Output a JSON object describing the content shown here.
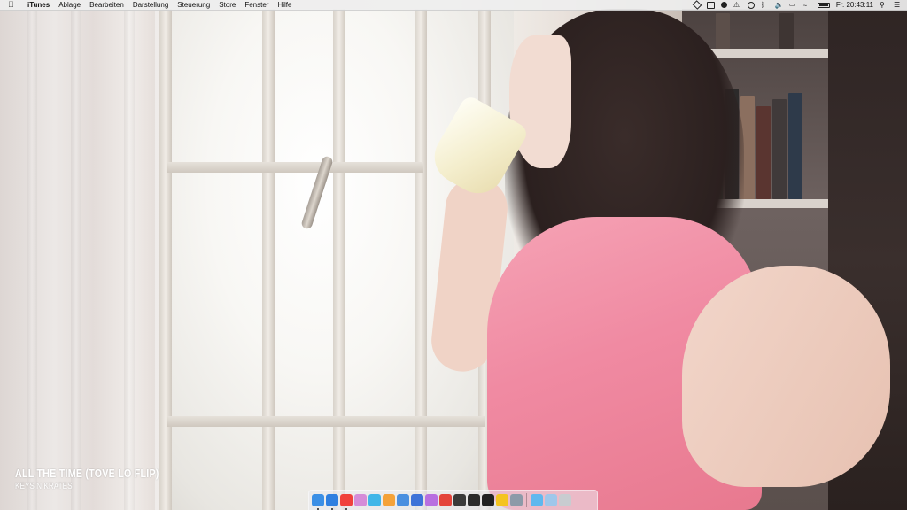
{
  "menubar": {
    "apple_icon": "apple-icon",
    "app_name": "iTunes",
    "items": [
      "Ablage",
      "Bearbeiten",
      "Darstellung",
      "Steuerung",
      "Store",
      "Fenster",
      "Hilfe"
    ],
    "clock": "Fr. 20:43:11",
    "status_icons": [
      "dropbox-icon",
      "display-icon",
      "flux-icon",
      "notification-icon",
      "time-machine-icon",
      "bluetooth-icon",
      "volume-icon",
      "airplay-icon",
      "wifi-icon",
      "battery-icon",
      "spotlight-icon",
      "notification-center-icon"
    ]
  },
  "now_playing": {
    "title": "ALL THE TIME (TOVE LO FLIP)",
    "artist": "KEYS N KRATES"
  },
  "dock": {
    "apps": [
      {
        "name": "finder-icon",
        "color": "#3b8fe6",
        "running": true
      },
      {
        "name": "safari-icon",
        "color": "#2f7fe0",
        "running": true
      },
      {
        "name": "itunes-icon",
        "color": "#f0413c",
        "running": true
      },
      {
        "name": "ai-app-icon",
        "color": "#d58cd8",
        "running": false
      },
      {
        "name": "app-teal-icon",
        "color": "#41b6e8",
        "running": false
      },
      {
        "name": "app-orange-icon",
        "color": "#f4a23a",
        "running": false
      },
      {
        "name": "app-blue-icon",
        "color": "#4a8fe0",
        "running": false
      },
      {
        "name": "app-blue2-icon",
        "color": "#3d72d8",
        "running": false
      },
      {
        "name": "app-purple-icon",
        "color": "#b86fe0",
        "running": false
      },
      {
        "name": "app-red-icon",
        "color": "#e4443c",
        "running": false
      },
      {
        "name": "app-dark-icon",
        "color": "#3a3a3a",
        "running": false
      },
      {
        "name": "app-monitor-icon",
        "color": "#2b2b2b",
        "running": false
      },
      {
        "name": "app-yinyang-icon",
        "color": "#222222",
        "running": false
      },
      {
        "name": "app-duck-icon",
        "color": "#f4c420",
        "running": false
      },
      {
        "name": "app-gray-icon",
        "color": "#8c9aa8",
        "running": false
      },
      {
        "name": "folder-icon",
        "color": "#5fb8ee",
        "running": false
      },
      {
        "name": "downloads-icon",
        "color": "#9fc7ea",
        "running": false
      },
      {
        "name": "trash-icon",
        "color": "#c8ccd0",
        "running": false
      }
    ]
  }
}
